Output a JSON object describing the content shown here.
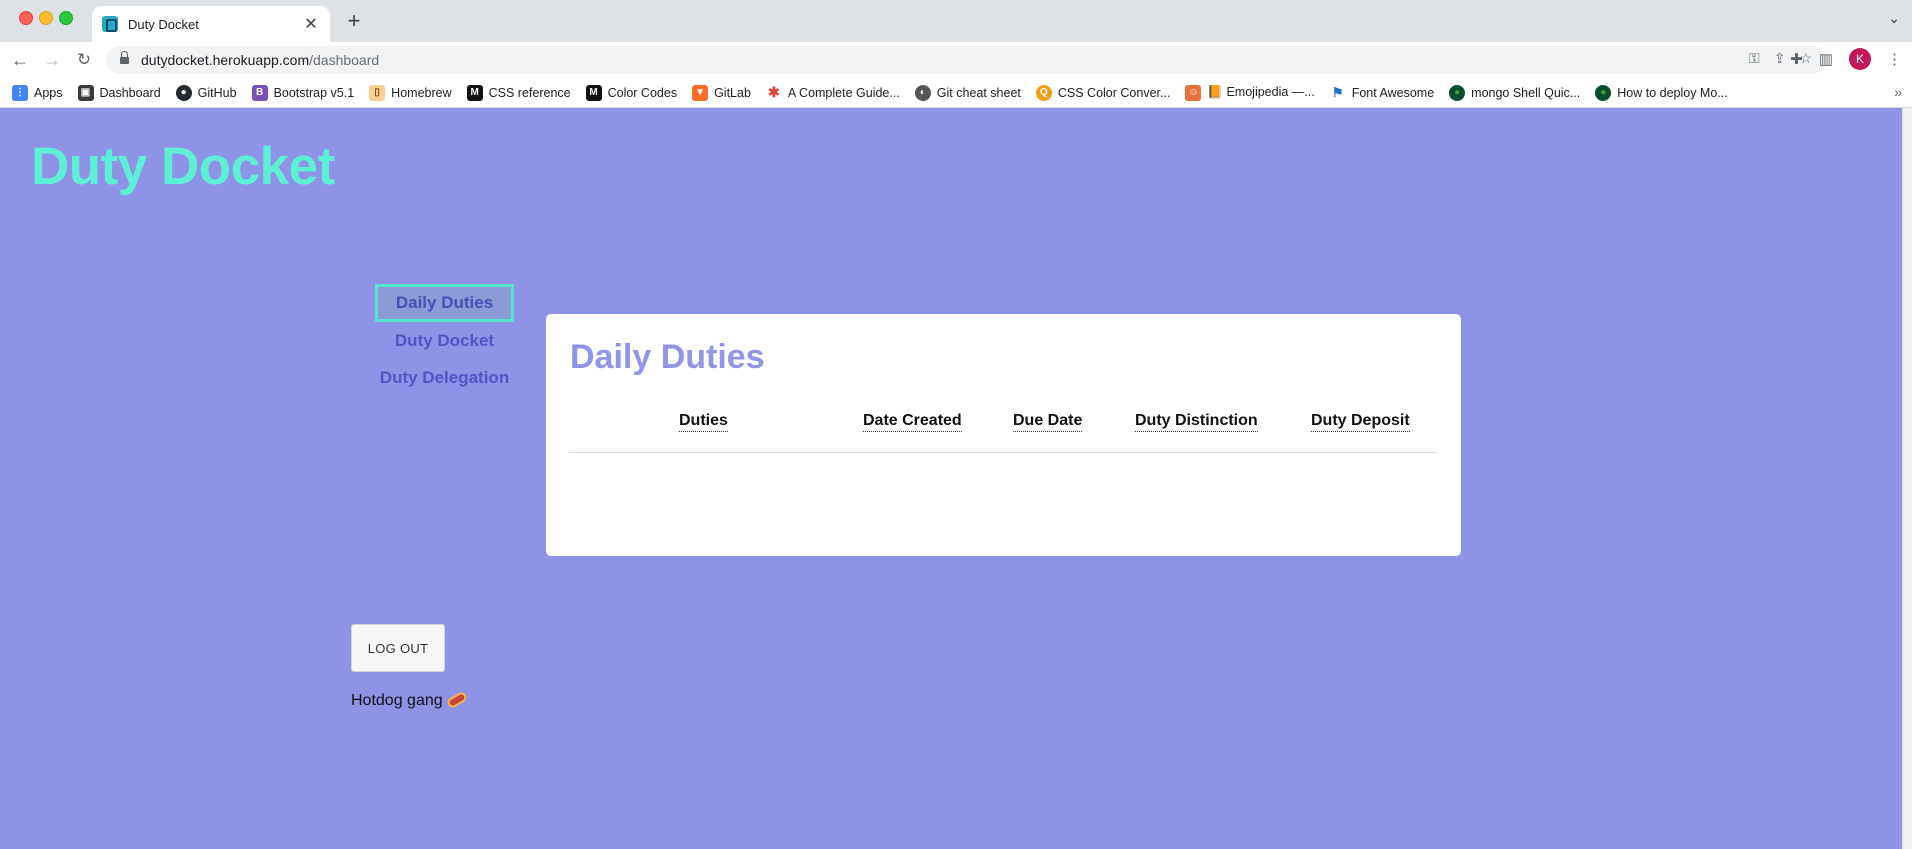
{
  "browser": {
    "tab_title": "Duty Docket",
    "url_host": "dutydocket.herokuapp.com",
    "url_path": "/dashboard",
    "profile_initial": "K",
    "bookmarks": [
      {
        "label": "Apps",
        "icon": "apps-grid-icon",
        "color": "#4285f4"
      },
      {
        "label": "Dashboard",
        "icon": "dashboard-icon",
        "color": "#3a3a3a"
      },
      {
        "label": "GitHub",
        "icon": "github-icon",
        "color": "#24292f"
      },
      {
        "label": "Bootstrap v5.1",
        "icon": "bootstrap-icon",
        "color": "#7952b3"
      },
      {
        "label": "Homebrew",
        "icon": "homebrew-icon",
        "color": "#f9d094"
      },
      {
        "label": "CSS reference",
        "icon": "css-reference-icon",
        "color": "#111111"
      },
      {
        "label": "Color Codes",
        "icon": "color-codes-icon",
        "color": "#111111"
      },
      {
        "label": "GitLab",
        "icon": "gitlab-icon",
        "color": "#fc6d26"
      },
      {
        "label": "A Complete Guide...",
        "icon": "css-tricks-icon",
        "color": "#e0443e"
      },
      {
        "label": "Git cheat sheet",
        "icon": "git-icon",
        "color": "#555555"
      },
      {
        "label": "CSS Color Conver...",
        "icon": "color-converter-icon",
        "color": "#f29d1a"
      },
      {
        "label": "📙 Emojipedia —...",
        "icon": "emojipedia-icon",
        "color": "#e8713a"
      },
      {
        "label": "Font Awesome",
        "icon": "font-awesome-flag-icon",
        "color": "#1c6ed6"
      },
      {
        "label": "mongo Shell Quic...",
        "icon": "mongodb-icon",
        "color": "#0a4d2f"
      },
      {
        "label": "How to deploy Mo...",
        "icon": "mongodb-icon",
        "color": "#0a4d2f"
      }
    ]
  },
  "site": {
    "title": "Duty Docket"
  },
  "nav": {
    "items": [
      {
        "label": "Daily Duties",
        "active": true
      },
      {
        "label": "Duty Docket",
        "active": false
      },
      {
        "label": "Duty Delegation",
        "active": false
      }
    ]
  },
  "card": {
    "title": "Daily Duties",
    "columns": [
      "Duties",
      "Date Created",
      "Due Date",
      "Duty Distinction",
      "Duty Deposit"
    ]
  },
  "actions": {
    "logout_label": "LOG OUT"
  },
  "footer": {
    "text": "Hotdog gang"
  },
  "colors": {
    "page_background": "#8f93e8",
    "title_accent": "#5ef0d4",
    "nav_text": "#5154c4",
    "card_title": "#9195e9"
  }
}
